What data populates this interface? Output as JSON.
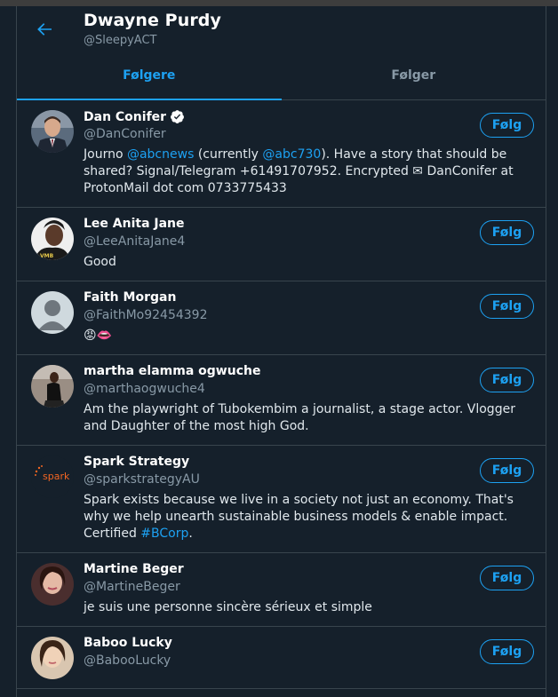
{
  "header": {
    "title": "Dwayne Purdy",
    "handle": "@SleepyACT"
  },
  "tabs": [
    {
      "label": "Følgere",
      "active": true
    },
    {
      "label": "Følger",
      "active": false
    }
  ],
  "follow_label": "Følg",
  "users": [
    {
      "name": "Dan Conifer",
      "handle": "@DanConifer",
      "verified": true,
      "bio_parts": [
        "Journo ",
        "@abcnews",
        " (currently ",
        "@abc730",
        "). Have a story that should be shared? Signal/Telegram +61491707952. Encrypted ✉ DanConifer at ProtonMail dot com 0733775433"
      ]
    },
    {
      "name": "Lee Anita Jane",
      "handle": "@LeeAnitaJane4",
      "bio": "Good"
    },
    {
      "name": "Faith Morgan",
      "handle": "@FaithMo92454392",
      "bio": "😡👄"
    },
    {
      "name": "martha elamma ogwuche",
      "handle": "@marthaogwuche4",
      "bio": "Am the playwright of Tubokembim a journalist, a stage actor. Vlogger and Daughter of the most high God."
    },
    {
      "name": "Spark Strategy",
      "handle": "@sparkstrategyAU",
      "avatar_text": "spark",
      "bio_parts": [
        "Spark exists because we live in a society not just an economy. That's why we help unearth sustainable business models & enable impact. Certified ",
        "#BCorp",
        "."
      ]
    },
    {
      "name": "Martine Beger",
      "handle": "@MartineBeger",
      "bio": "je suis une personne sincère sérieux et simple"
    },
    {
      "name": "Baboo Lucky",
      "handle": "@BabooLucky",
      "bio": ""
    }
  ],
  "colors": {
    "background": "#15202b",
    "accent": "#1da1f2",
    "secondary_text": "#8899a6",
    "border": "#38444d"
  }
}
